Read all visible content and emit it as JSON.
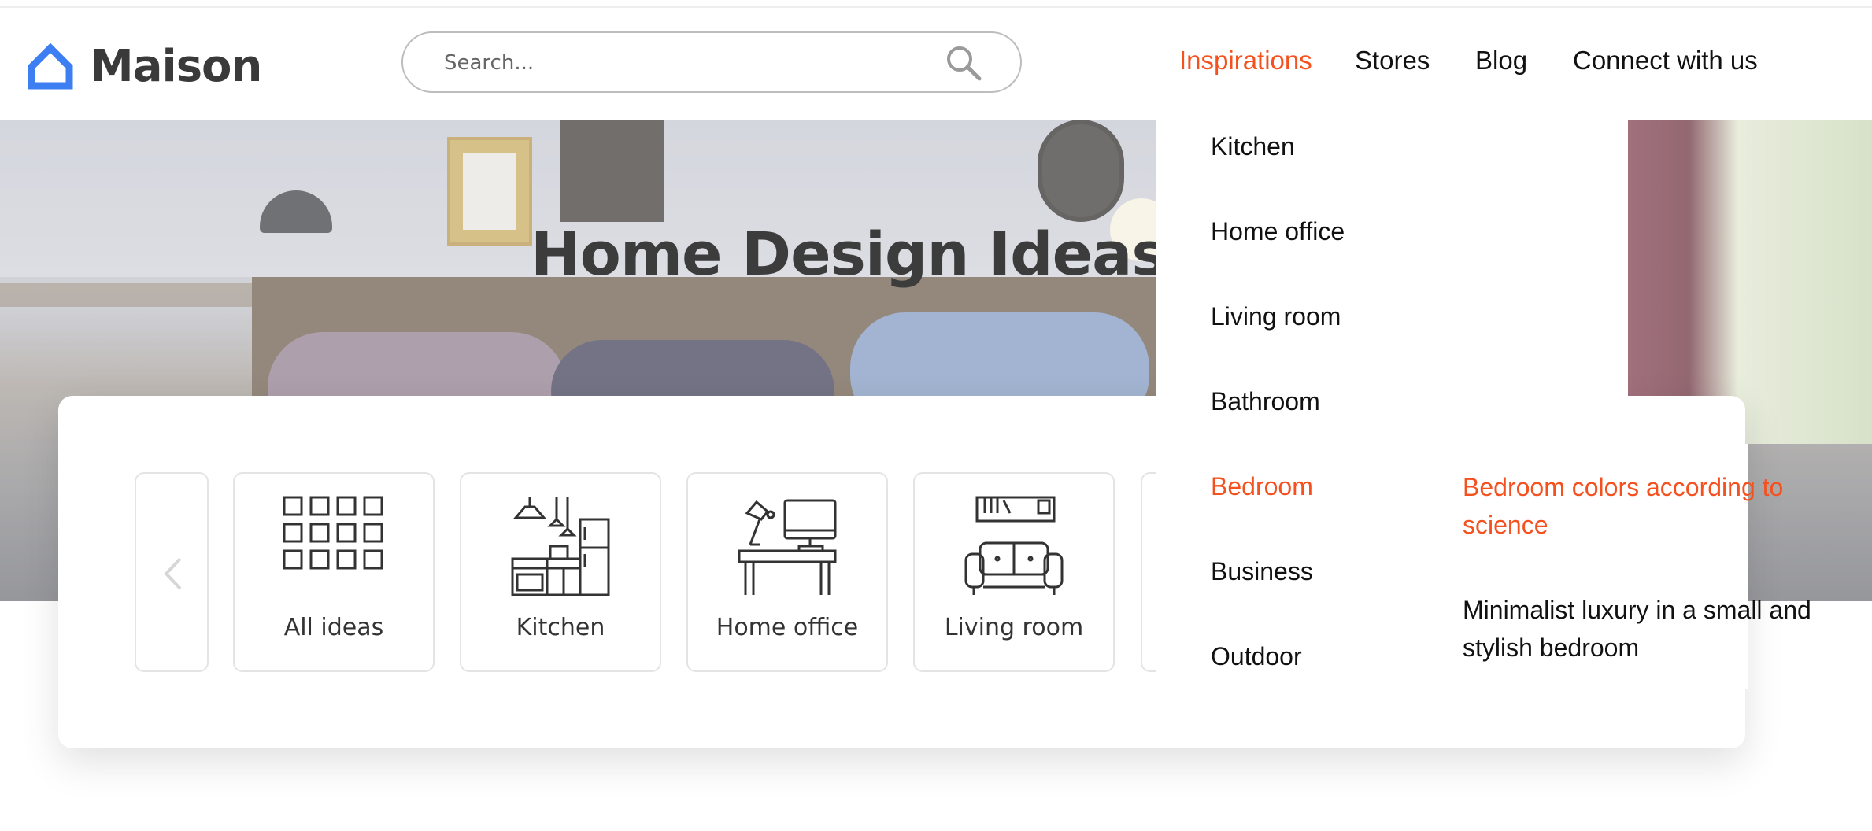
{
  "brand": {
    "name": "Maison",
    "accent": "#3d7ff2"
  },
  "search": {
    "placeholder": "Search..."
  },
  "nav": [
    {
      "label": "Inspirations",
      "active": true
    },
    {
      "label": "Stores"
    },
    {
      "label": "Blog"
    },
    {
      "label": "Connect with us"
    }
  ],
  "hero": {
    "title": "Home Design Ideas &"
  },
  "categories": [
    {
      "label": "All ideas",
      "icon": "grid-icon"
    },
    {
      "label": "Kitchen",
      "icon": "kitchen-icon"
    },
    {
      "label": "Home office",
      "icon": "desk-icon"
    },
    {
      "label": "Living room",
      "icon": "sofa-icon"
    }
  ],
  "dropdown": {
    "items": [
      "Kitchen",
      "Home office",
      "Living room",
      "Bathroom",
      "Bedroom",
      "Business",
      "Outdoor"
    ],
    "active": "Bedroom",
    "submenu": [
      "Bedroom colors according to science",
      "Minimalist luxury in a small and stylish bedroom"
    ]
  },
  "colors": {
    "active": "#f4511e",
    "text": "#111111"
  }
}
